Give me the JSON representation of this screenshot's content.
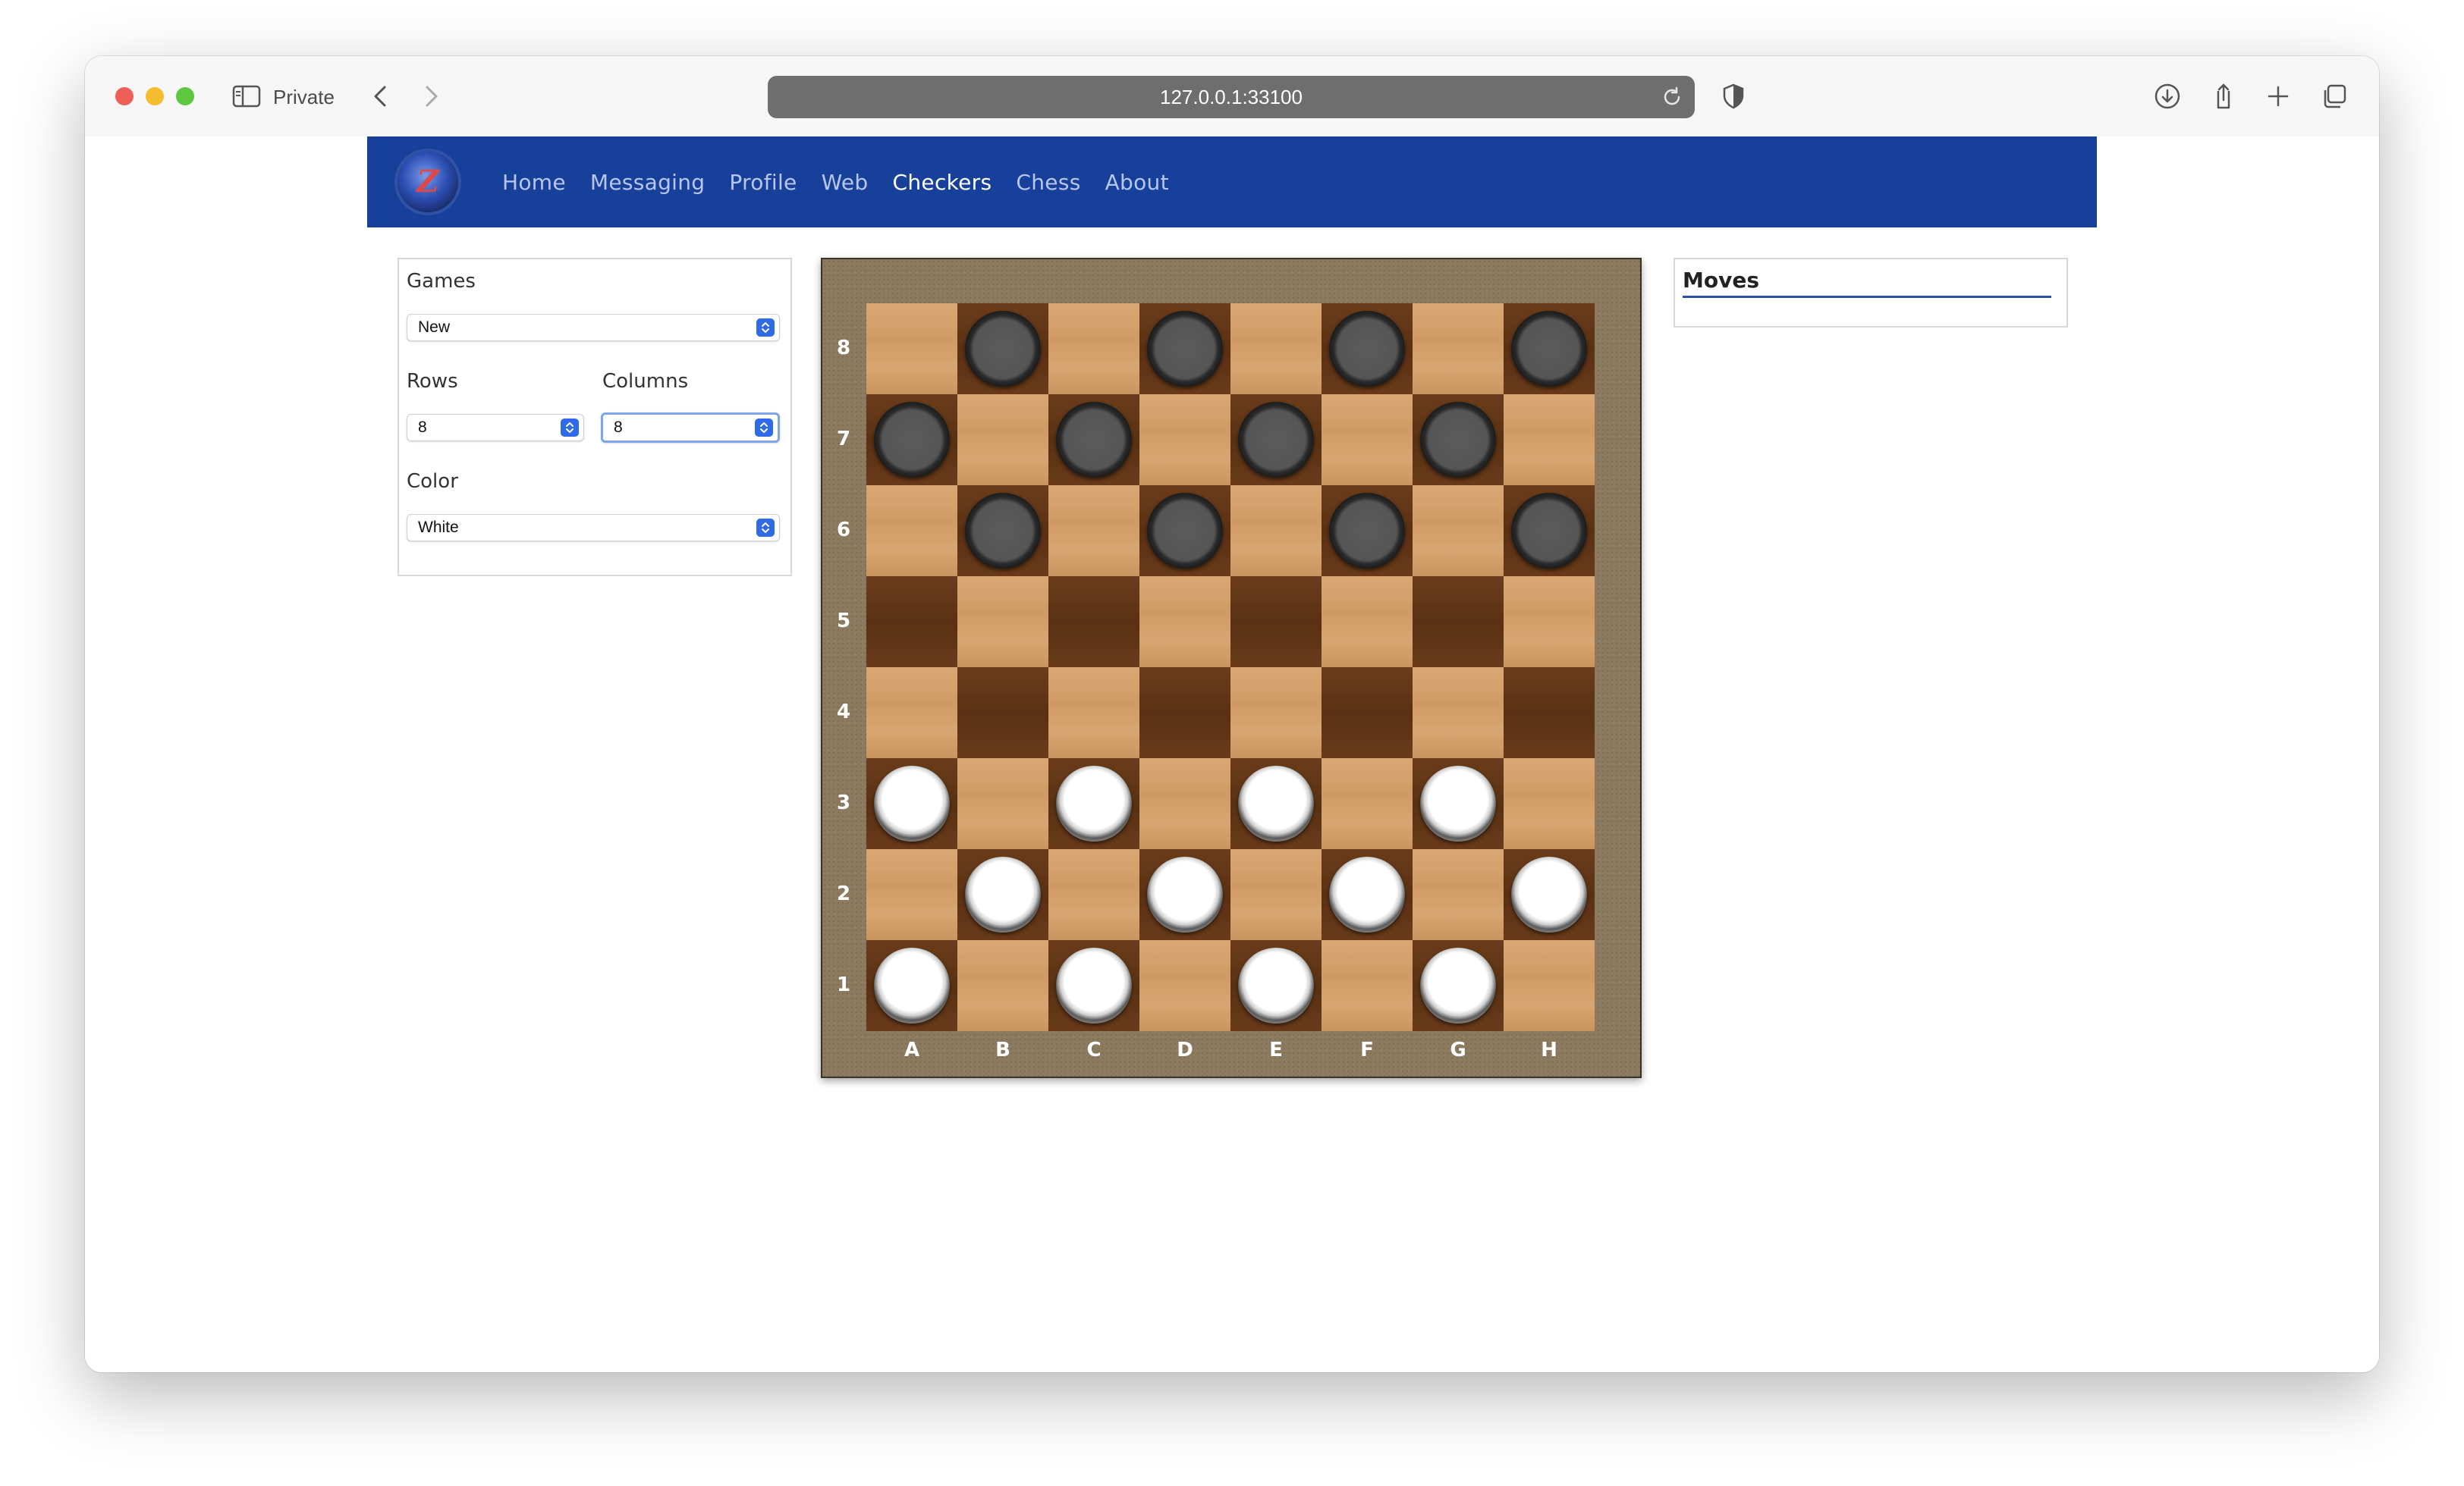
{
  "browser": {
    "mode_label": "Private",
    "url": "127.0.0.1:33100"
  },
  "nav": {
    "links": [
      "Home",
      "Messaging",
      "Profile",
      "Web",
      "Checkers",
      "Chess",
      "About"
    ],
    "active": "Checkers"
  },
  "settings": {
    "games_label": "Games",
    "games_value": "New",
    "rows_label": "Rows",
    "rows_value": "8",
    "columns_label": "Columns",
    "columns_value": "8",
    "color_label": "Color",
    "color_value": "White"
  },
  "board": {
    "files": [
      "A",
      "B",
      "C",
      "D",
      "E",
      "F",
      "G",
      "H"
    ],
    "ranks": [
      "8",
      "7",
      "6",
      "5",
      "4",
      "3",
      "2",
      "1"
    ],
    "rows": [
      [
        "",
        "B",
        "",
        "B",
        "",
        "B",
        "",
        "B"
      ],
      [
        "B",
        "",
        "B",
        "",
        "B",
        "",
        "B",
        ""
      ],
      [
        "",
        "B",
        "",
        "B",
        "",
        "B",
        "",
        "B"
      ],
      [
        "",
        "",
        "",
        "",
        "",
        "",
        "",
        ""
      ],
      [
        "",
        "",
        "",
        "",
        "",
        "",
        "",
        ""
      ],
      [
        "W",
        "",
        "W",
        "",
        "W",
        "",
        "W",
        ""
      ],
      [
        "",
        "W",
        "",
        "W",
        "",
        "W",
        "",
        "W"
      ],
      [
        "W",
        "",
        "W",
        "",
        "W",
        "",
        "W",
        ""
      ]
    ]
  },
  "moves": {
    "title": "Moves"
  }
}
